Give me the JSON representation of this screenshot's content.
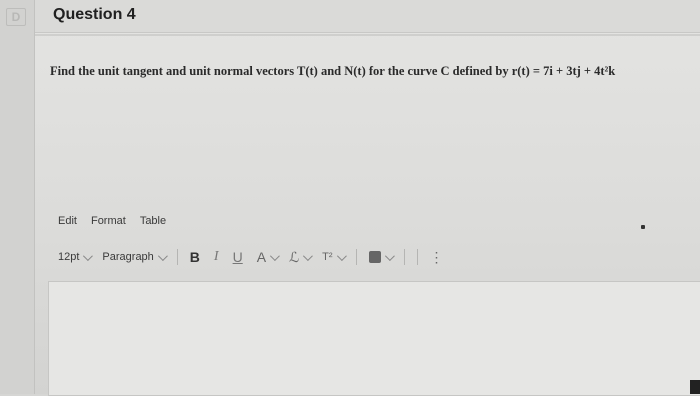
{
  "question": {
    "number_badge": "D",
    "title": "Question 4",
    "text": "Find the unit tangent and unit normal vectors T(t) and N(t) for the curve C defined by r(t) = 7i + 3tj + 4t²k"
  },
  "editor": {
    "menu": [
      "Edit",
      "Format",
      "Table"
    ],
    "font_size": "12pt",
    "block_format": "Paragraph",
    "bold_label": "B",
    "italic_label": "I",
    "underline_label": "U",
    "text_color_label": "A",
    "highlight_label": "ℒ",
    "superscript_label": "T²",
    "more_label": "⋮"
  }
}
